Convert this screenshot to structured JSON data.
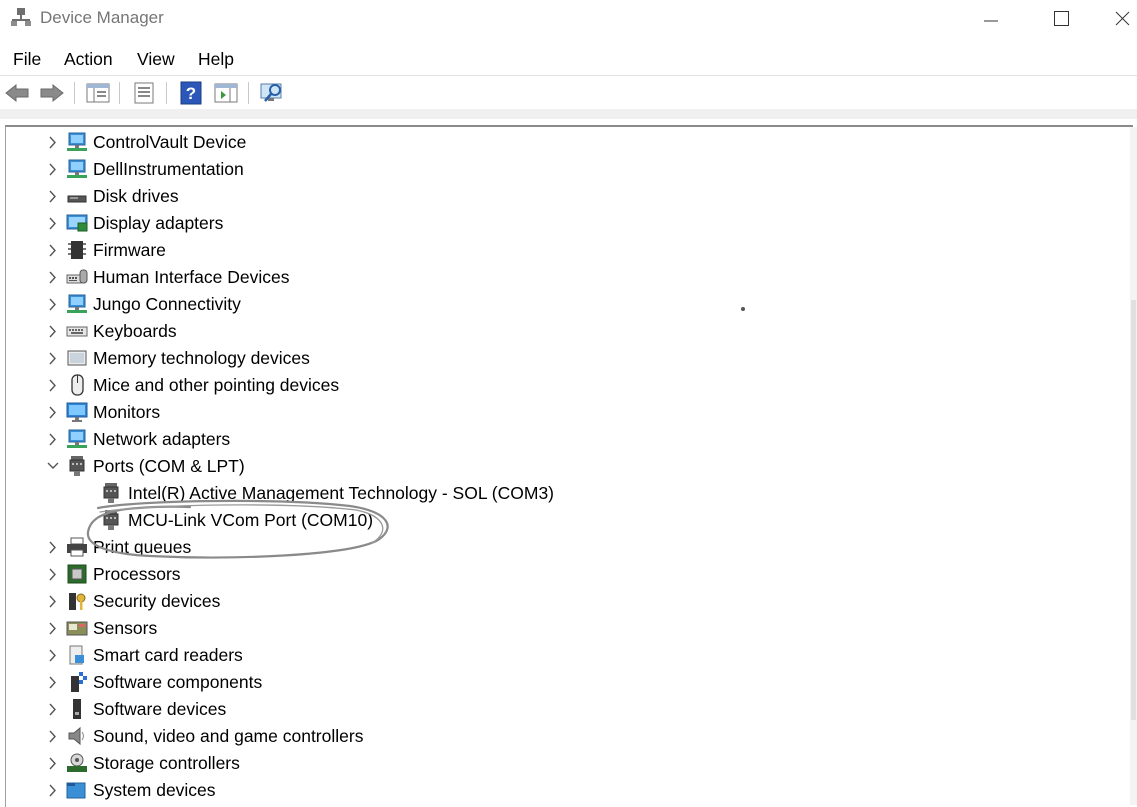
{
  "window": {
    "title": "Device Manager"
  },
  "menu": [
    "File",
    "Action",
    "View",
    "Help"
  ],
  "icons": {
    "app": "device-manager-icon",
    "toolbar": [
      "back-arrow-icon",
      "forward-arrow-icon",
      "properties-pane-icon",
      "driver-details-icon",
      "help-icon",
      "action-pane-icon",
      "scan-hardware-icon"
    ]
  },
  "tree": {
    "items": [
      {
        "label": "ControlVault Device",
        "icon": "monitor-network-icon",
        "expanded": false
      },
      {
        "label": "DellInstrumentation",
        "icon": "monitor-network-icon",
        "expanded": false
      },
      {
        "label": "Disk drives",
        "icon": "disk-drive-icon",
        "expanded": false
      },
      {
        "label": "Display adapters",
        "icon": "display-adapter-icon",
        "expanded": false
      },
      {
        "label": "Firmware",
        "icon": "firmware-chip-icon",
        "expanded": false
      },
      {
        "label": "Human Interface Devices",
        "icon": "hid-icon",
        "expanded": false
      },
      {
        "label": "Jungo Connectivity",
        "icon": "monitor-network-icon",
        "expanded": false
      },
      {
        "label": "Keyboards",
        "icon": "keyboard-icon",
        "expanded": false
      },
      {
        "label": "Memory technology devices",
        "icon": "memory-device-icon",
        "expanded": false
      },
      {
        "label": "Mice and other pointing devices",
        "icon": "mouse-icon",
        "expanded": false
      },
      {
        "label": "Monitors",
        "icon": "monitor-icon",
        "expanded": false
      },
      {
        "label": "Network adapters",
        "icon": "monitor-network-icon",
        "expanded": false
      },
      {
        "label": "Ports (COM & LPT)",
        "icon": "port-connector-icon",
        "expanded": true
      },
      {
        "label": "Intel(R) Active Management Technology - SOL (COM3)",
        "icon": "port-connector-icon",
        "child": true
      },
      {
        "label": "MCU-Link VCom Port (COM10)",
        "icon": "port-connector-icon",
        "child": true,
        "circled": true
      },
      {
        "label": "Print queues",
        "icon": "printer-icon",
        "expanded": false
      },
      {
        "label": "Processors",
        "icon": "processor-icon",
        "expanded": false
      },
      {
        "label": "Security devices",
        "icon": "security-key-icon",
        "expanded": false
      },
      {
        "label": "Sensors",
        "icon": "sensor-icon",
        "expanded": false
      },
      {
        "label": "Smart card readers",
        "icon": "smart-card-reader-icon",
        "expanded": false
      },
      {
        "label": "Software components",
        "icon": "software-component-icon",
        "expanded": false
      },
      {
        "label": "Software devices",
        "icon": "software-device-icon",
        "expanded": false
      },
      {
        "label": "Sound, video and game controllers",
        "icon": "speaker-icon",
        "expanded": false
      },
      {
        "label": "Storage controllers",
        "icon": "storage-controller-icon",
        "expanded": false
      },
      {
        "label": "System devices",
        "icon": "system-folder-icon",
        "expanded": false
      }
    ]
  },
  "colors": {
    "annotation": "#8a8a8a",
    "title_text": "#767676",
    "chevron": "#555555"
  }
}
